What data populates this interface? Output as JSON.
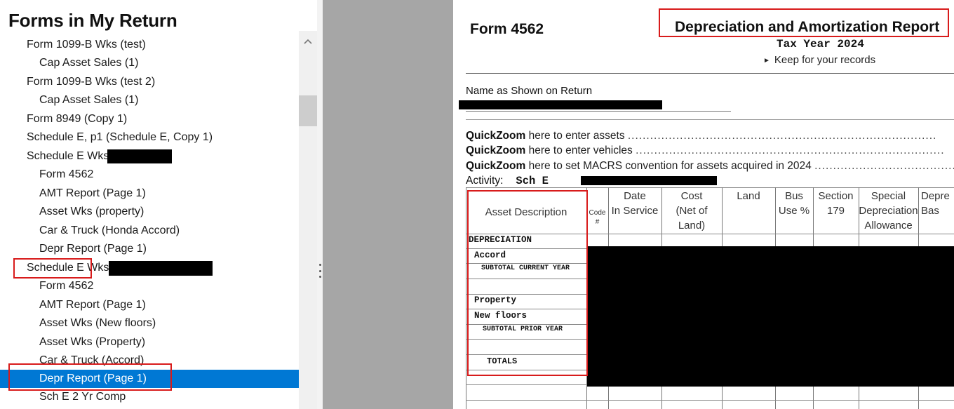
{
  "left_panel": {
    "title": "Forms in My Return",
    "items": [
      {
        "label": "Form 1099-B Wks (test)",
        "level": 1
      },
      {
        "label": "Cap Asset Sales (1)",
        "level": 2
      },
      {
        "label": "Form 1099-B Wks (test 2)",
        "level": 1
      },
      {
        "label": "Cap Asset Sales (1)",
        "level": 2
      },
      {
        "label": "Form 8949 (Copy 1)",
        "level": 1
      },
      {
        "label": "Schedule E, p1 (Schedule E, Copy 1)",
        "level": 1
      },
      {
        "label": "Schedule E Wks",
        "level": 1
      },
      {
        "label": "Form 4562",
        "level": 2
      },
      {
        "label": "AMT Report (Page 1)",
        "level": 2
      },
      {
        "label": "Asset Wks (property)",
        "level": 2
      },
      {
        "label": "Car & Truck (Honda Accord)",
        "level": 2
      },
      {
        "label": "Depr Report (Page 1)",
        "level": 2
      },
      {
        "label": "Schedule E Wks",
        "level": 1
      },
      {
        "label": "Form 4562",
        "level": 2
      },
      {
        "label": "AMT Report (Page 1)",
        "level": 2
      },
      {
        "label": "Asset Wks (New floors)",
        "level": 2
      },
      {
        "label": "Asset Wks (Property)",
        "level": 2
      },
      {
        "label": "Car & Truck (Accord)",
        "level": 2
      },
      {
        "label": "Depr Report (Page 1)",
        "level": 2,
        "selected": true
      },
      {
        "label": "Sch E 2 Yr Comp",
        "level": 2
      }
    ]
  },
  "form": {
    "form_number": "Form 4562",
    "title": "Depreciation and Amortization Report",
    "tax_year": "Tax Year 2024",
    "keep_records": "Keep for your records",
    "name_label": "Name as Shown on Return",
    "quickzoom": [
      {
        "bold": "QuickZoom",
        "text": " here to enter assets "
      },
      {
        "bold": "QuickZoom",
        "text": " here to enter vehicles "
      },
      {
        "bold": "QuickZoom",
        "text": " here to set MACRS convention for assets acquired in 2024 "
      }
    ],
    "dots": "...................................................................................",
    "activity_label": "Activity:",
    "activity_value": "Sch E",
    "columns": [
      {
        "label": "Asset Description"
      },
      {
        "label": "Code\n#"
      },
      {
        "label": "Date\nIn Service"
      },
      {
        "label": "Cost\n(Net of\nLand)"
      },
      {
        "label": "Land"
      },
      {
        "label": "Bus\nUse %"
      },
      {
        "label": "Section\n179"
      },
      {
        "label": "Special\nDepreciation\nAllowance"
      },
      {
        "label": "Depre\nBas"
      }
    ],
    "rows": [
      {
        "label": "DEPRECIATION"
      },
      {
        "label": "Accord"
      },
      {
        "label": "SUBTOTAL CURRENT YEAR"
      },
      {
        "label": ""
      },
      {
        "label": "Property"
      },
      {
        "label": "New floors"
      },
      {
        "label": "SUBTOTAL PRIOR YEAR"
      },
      {
        "label": ""
      },
      {
        "label": "TOTALS"
      }
    ]
  },
  "colors": {
    "selection": "#0078d4",
    "highlight_box": "#d81b1b",
    "gutter": "#a6a6a6",
    "redaction": "#000000"
  }
}
